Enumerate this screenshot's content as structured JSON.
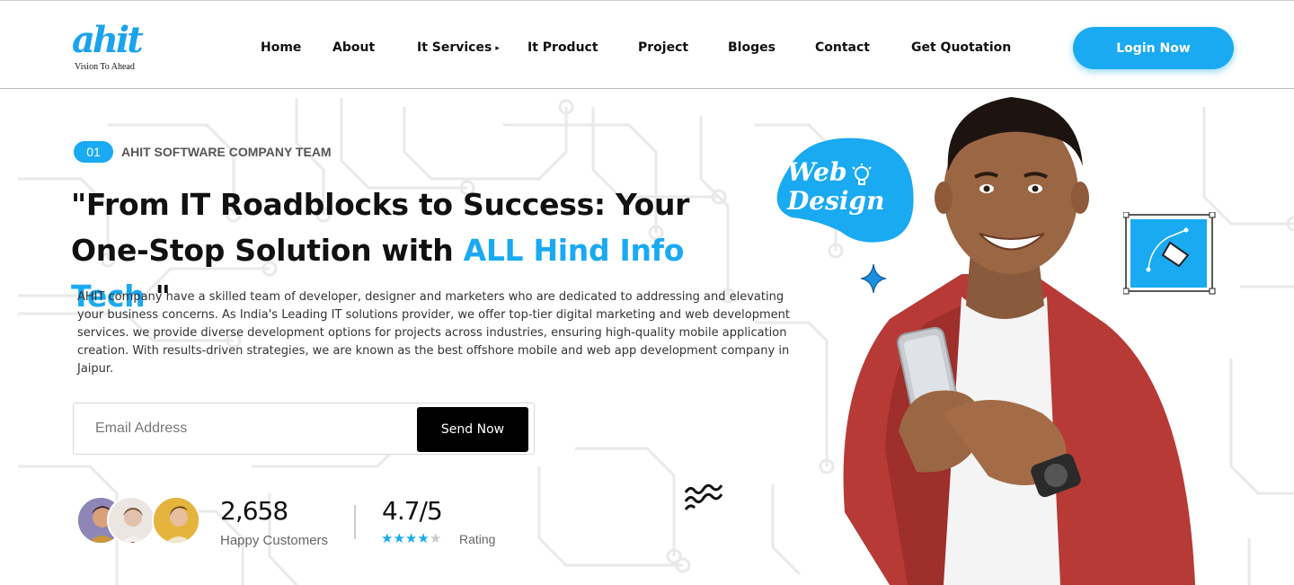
{
  "brand": {
    "logo_text": "ahit",
    "tagline": "Vision To Ahead",
    "accent_color": "#19aaf2"
  },
  "nav": {
    "items": [
      {
        "label": "Home"
      },
      {
        "label": "About"
      },
      {
        "label": "It Services",
        "has_dropdown": true
      },
      {
        "label": "It Product"
      },
      {
        "label": "Project"
      },
      {
        "label": "Bloges"
      },
      {
        "label": "Contact"
      },
      {
        "label": "Get Quotation"
      }
    ],
    "dropdown_caret": "▸",
    "login_label": "Login Now"
  },
  "hero": {
    "badge_number": "01",
    "badge_text": "AHIT SOFTWARE COMPANY TEAM",
    "headline_part1": "\"From IT Roadblocks to Success: Your One-Stop Solution with ",
    "headline_accent": "ALL Hind Info Tech",
    "headline_part2": " \"",
    "description": "AHIT company have a skilled team of developer, designer and marketers who are dedicated to addressing and elevating your business concerns. As India's Leading IT solutions provider, we offer top-tier digital marketing and web development services. we provide diverse development options for projects across industries, ensuring high-quality mobile application creation. With results-driven strategies, we are known as the best offshore mobile and web app development company in Jaipur.",
    "email_placeholder": "Email Address",
    "send_label": "Send Now"
  },
  "stats": {
    "customers_value": "2,658",
    "customers_label": "Happy Customers",
    "rating_value": "4.7/5",
    "rating_label": "Rating",
    "rating_stars_filled": 4,
    "rating_stars_total": 5
  },
  "illustration": {
    "blob_line1": "Web",
    "blob_line2": "Design",
    "icons": [
      "lightbulb-icon",
      "sparkle-icon",
      "squiggle-icon",
      "pen-tool-icon"
    ]
  }
}
